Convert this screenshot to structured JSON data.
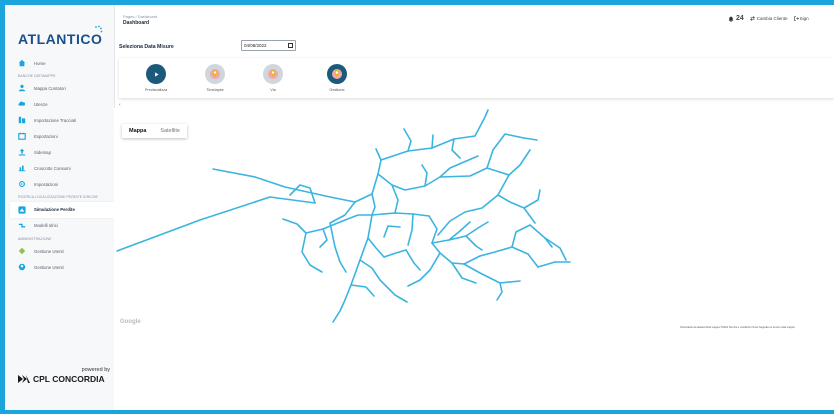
{
  "app": {
    "logo_text": "ATLANTICO",
    "powered_by": "powered by",
    "company": "CPL CONCORDIA"
  },
  "sidebar": {
    "items": [
      {
        "label": "Home",
        "icon": "home-icon"
      },
      {
        "section": "BANCHE DATI/MAPPE"
      },
      {
        "label": "Mappa Contatori",
        "icon": "person-icon"
      },
      {
        "label": "Utenze",
        "icon": "cloud-icon"
      },
      {
        "label": "Importazione Tracciati",
        "icon": "import-icon"
      },
      {
        "label": "Esportazioni",
        "icon": "export-icon"
      },
      {
        "label": "Sidemap",
        "icon": "upload-icon"
      },
      {
        "label": "Cruscotto Consumi",
        "icon": "chart-icon"
      },
      {
        "label": "Impostazioni",
        "icon": "settings-icon"
      },
      {
        "section": "RICERCA LOCALIZZAZIONE PERDITE IDRICHE"
      },
      {
        "label": "Simulazione Perdite",
        "icon": "simulation-icon",
        "active": true
      },
      {
        "label": "Modelli Idrici",
        "icon": "model-icon"
      },
      {
        "section": "AMMINISTRAZIONE"
      },
      {
        "label": "Gestione Utenti",
        "icon": "users-icon"
      },
      {
        "label": "Gestione Utenti",
        "icon": "user-admin-icon"
      }
    ]
  },
  "header": {
    "breadcrumb": "Pages / Dashboard",
    "title": "Dashboard",
    "notification_count": "24",
    "change_client": "Cambia Cliente",
    "sign_out": "Sign"
  },
  "datebar": {
    "label": "Seleziona Data Misure",
    "date_value": "04/08/2022"
  },
  "tools": [
    {
      "label": "Previsualizza",
      "color": "#1b5a7a"
    },
    {
      "label": "Timelapse",
      "color": "#f2a7b6"
    },
    {
      "label": "Via",
      "color": "#f2a7b6"
    },
    {
      "label": "Gestione",
      "color": "#1b5a7a"
    }
  ],
  "map": {
    "type_map": "Mappa",
    "type_satellite": "Satellite",
    "google": "Google",
    "attribution": "Scorciatoie da tastiera   Dati mappa ©2022   Termini e condizioni d'uso   Segnala un errore nella mappa",
    "network_color": "#3bb4e0"
  },
  "colors": {
    "accent": "#1aa6dc",
    "brand": "#1b4f8a"
  }
}
